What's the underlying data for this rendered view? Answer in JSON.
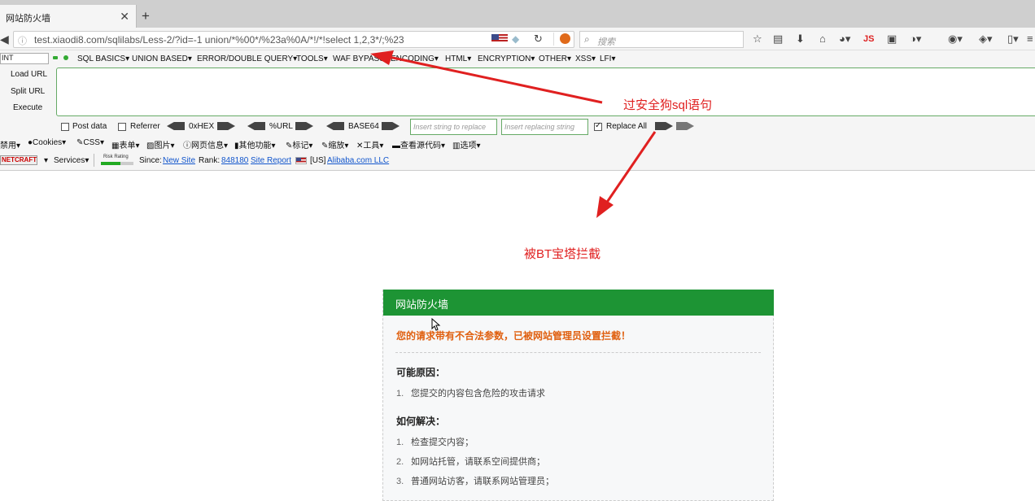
{
  "browser": {
    "tab_title": "网站防火墙",
    "tab_close": "✕",
    "new_tab": "+",
    "url": "test.xiaodi8.com/sqlilabs/Less-2/?id=-1 union/*%00*/%23a%0A/*!/*!select 1,2,3*/;%23",
    "search_placeholder": "搜索",
    "js_label": "JS"
  },
  "hackbar": {
    "select_value": "INT",
    "menus": [
      "SQL BASICS▾",
      "UNION BASED▾",
      "ERROR/DOUBLE QUERY▾",
      "TOOLS▾",
      "WAF BYPASS▾",
      "ENCODING▾",
      "HTML▾",
      "ENCRYPTION▾",
      "OTHER▾",
      "XSS▾",
      "LFI▾"
    ],
    "load_url": "Load URL",
    "split_url": "Split URL",
    "execute": "Execute",
    "post_data": "Post data",
    "referrer": "Referrer",
    "hex": "0xHEX",
    "url_enc": "%URL",
    "base64": "BASE64",
    "insert_placeholder": "Insert string to replace",
    "replacing_placeholder": "Insert replacing string",
    "replace_all": "Replace All"
  },
  "webdev_toolbar": {
    "items": [
      "禁用▾",
      "Cookies▾",
      "CSS▾",
      "表单▾",
      "图片▾",
      "网页信息▾",
      "其他功能▾",
      "标记▾",
      "缩放▾",
      "工具▾",
      "查看源代码▾",
      "选项▾"
    ]
  },
  "netcraft": {
    "logo": "NETCRAFT",
    "services": "Services▾",
    "risk_rating": "Risk Rating",
    "since_label": "Since:",
    "since_value": "New Site",
    "rank_label": "Rank:",
    "rank_value": "848180",
    "site_report": "Site Report",
    "country": "[US]",
    "host": "Alibaba.com LLC"
  },
  "annotations": {
    "top": "过安全狗sql语句",
    "bottom": "被BT宝塔拦截"
  },
  "firewall_card": {
    "title": "网站防火墙",
    "message": "您的请求带有不合法参数，已被网站管理员设置拦截！",
    "reason_heading": "可能原因：",
    "reasons": [
      "您提交的内容包含危险的攻击请求"
    ],
    "solution_heading": "如何解决：",
    "solutions": [
      "检查提交内容；",
      "如网站托管，请联系空间提供商；",
      "普通网站访客，请联系网站管理员；"
    ]
  },
  "colors": {
    "card_header": "#1d9434",
    "warning_text": "#e06010",
    "annotation": "#e02020"
  }
}
